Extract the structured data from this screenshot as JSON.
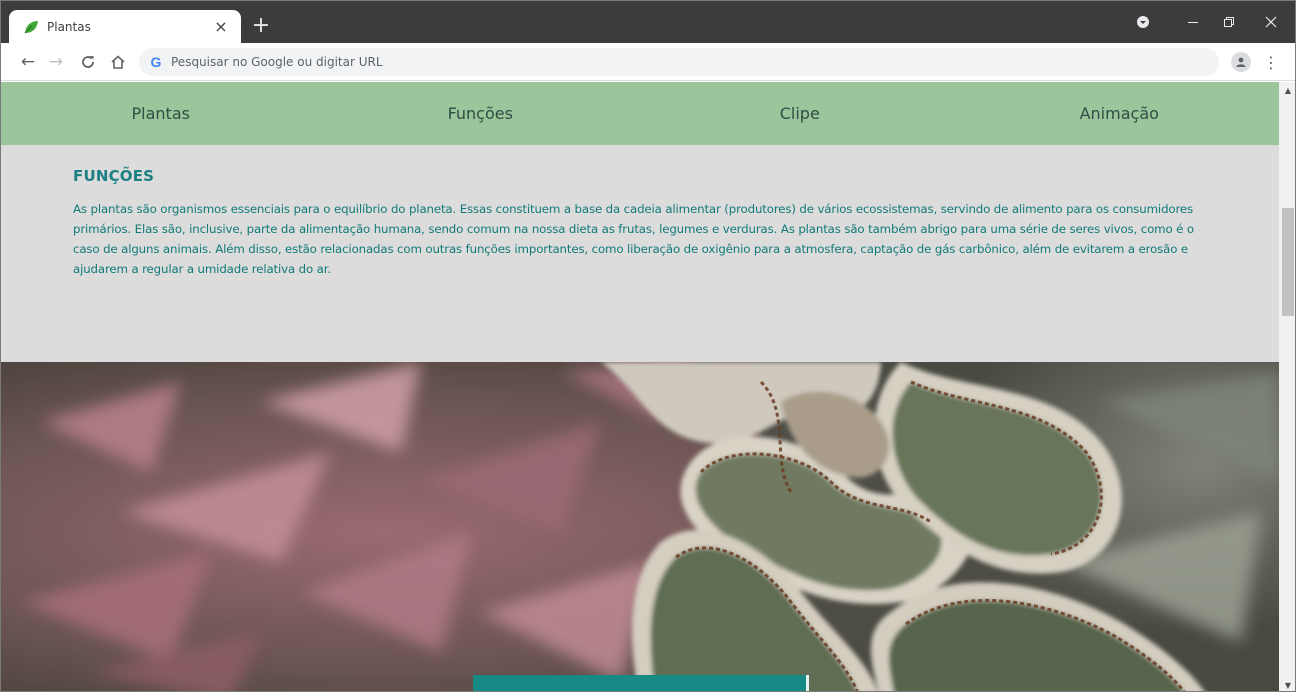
{
  "browser": {
    "tab": {
      "title": "Plantas",
      "close_glyph": "×",
      "favicon": "leaf-icon"
    },
    "new_tab_glyph": "+",
    "omnibox": {
      "placeholder": "Pesquisar no Google ou digitar URL",
      "value": "",
      "icon": "google-g-icon",
      "icon_glyph": "G"
    },
    "nav": {
      "back_glyph": "←",
      "forward_glyph": "→",
      "reload_glyph": "C",
      "home_glyph": "⌂"
    },
    "menu_glyph": "⋮"
  },
  "site": {
    "nav_items": [
      "Plantas",
      "Funções",
      "Clipe",
      "Animação"
    ],
    "section": {
      "title": "FUNÇÕES",
      "text": "As plantas são organismos essenciais para o equilíbrio do planeta. Essas constituem a base da cadeia alimentar (produtores) de vários ecossistemas, servindo de alimento para os consumidores primários. Elas são, inclusive, parte da alimentação humana, sendo comum na nossa dieta as frutas, legumes e verduras. As plantas são também abrigo para uma série de seres vivos, como é o caso de alguns animais. Além disso, estão relacionadas com outras funções importantes, como liberação de oxigênio para a atmosfera, captação de gás carbônico, além de evitarem a erosão e ajudarem a regular a umidade relativa do ar."
    }
  },
  "colors": {
    "tabstrip": "#3c3c3c",
    "navbar": "#9bc59a",
    "nav_text": "#2f4d44",
    "section_bg": "#dcdcdc",
    "section_text": "#127b78",
    "accent_teal": "#178a86"
  }
}
